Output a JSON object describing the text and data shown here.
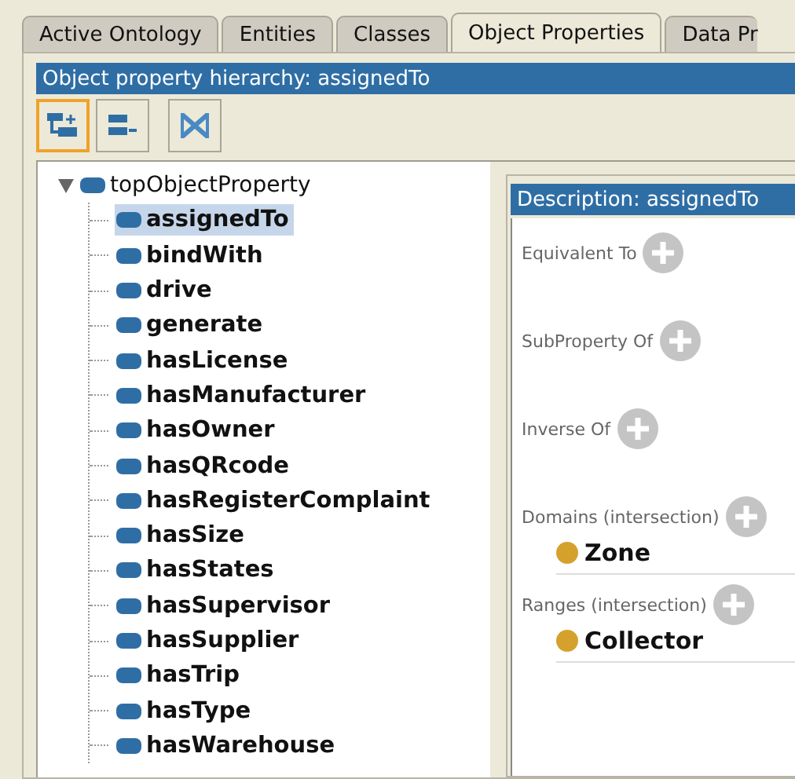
{
  "tabs": [
    {
      "label": "Active Ontology",
      "selected": false
    },
    {
      "label": "Entities",
      "selected": false
    },
    {
      "label": "Classes",
      "selected": false
    },
    {
      "label": "Object Properties",
      "selected": true
    },
    {
      "label": "Data Pr",
      "selected": false
    }
  ],
  "hierarchy": {
    "title": "Object property hierarchy: assignedTo",
    "toolbar": [
      {
        "kind": "add-sub",
        "selected": true
      },
      {
        "kind": "add-sibling",
        "selected": false
      },
      {
        "kind": "delete",
        "selected": false
      }
    ],
    "tree": [
      {
        "label": "topObjectProperty",
        "expanded": true,
        "selected": false,
        "children": [
          {
            "label": "assignedTo",
            "selected": true
          },
          {
            "label": "bindWith",
            "selected": false
          },
          {
            "label": "drive",
            "selected": false
          },
          {
            "label": "generate",
            "selected": false
          },
          {
            "label": "hasLicense",
            "selected": false
          },
          {
            "label": "hasManufacturer",
            "selected": false
          },
          {
            "label": "hasOwner",
            "selected": false
          },
          {
            "label": "hasQRcode",
            "selected": false
          },
          {
            "label": "hasRegisterComplaint",
            "selected": false
          },
          {
            "label": "hasSize",
            "selected": false
          },
          {
            "label": "hasStates",
            "selected": false
          },
          {
            "label": "hasSupervisor",
            "selected": false
          },
          {
            "label": "hasSupplier",
            "selected": false
          },
          {
            "label": "hasTrip",
            "selected": false
          },
          {
            "label": "hasType",
            "selected": false
          },
          {
            "label": "hasWarehouse",
            "selected": false
          }
        ]
      }
    ]
  },
  "description": {
    "title": "Description: assignedTo",
    "sections": [
      {
        "label": "Equivalent To"
      },
      {
        "label": "SubProperty Of"
      },
      {
        "label": "Inverse Of"
      },
      {
        "label": "Domains (intersection)",
        "items": [
          "Zone"
        ]
      },
      {
        "label": "Ranges (intersection)",
        "items": [
          "Collector"
        ]
      }
    ]
  }
}
